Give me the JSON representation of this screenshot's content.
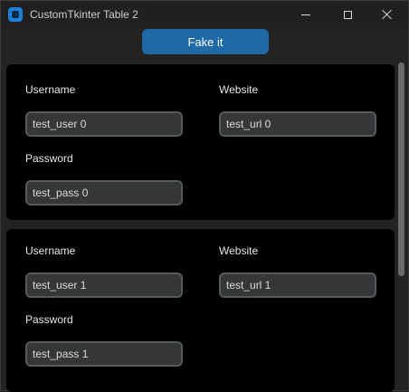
{
  "window": {
    "title": "CustomTkinter Table 2",
    "icon": "app-icon"
  },
  "toolbar": {
    "fake_label": "Fake it"
  },
  "rows": [
    {
      "username_label": "Username",
      "username_value": "test_user 0",
      "website_label": "Website",
      "website_value": "test_url 0",
      "password_label": "Password",
      "password_value": "test_pass 0"
    },
    {
      "username_label": "Username",
      "username_value": "test_user 1",
      "website_label": "Website",
      "website_value": "test_url 1",
      "password_label": "Password",
      "password_value": "test_pass 1"
    }
  ],
  "colors": {
    "accent": "#1f6aa5",
    "card_bg": "#000000",
    "field_bg": "#343638",
    "field_border": "#565b5e",
    "window_bg": "#232323"
  }
}
